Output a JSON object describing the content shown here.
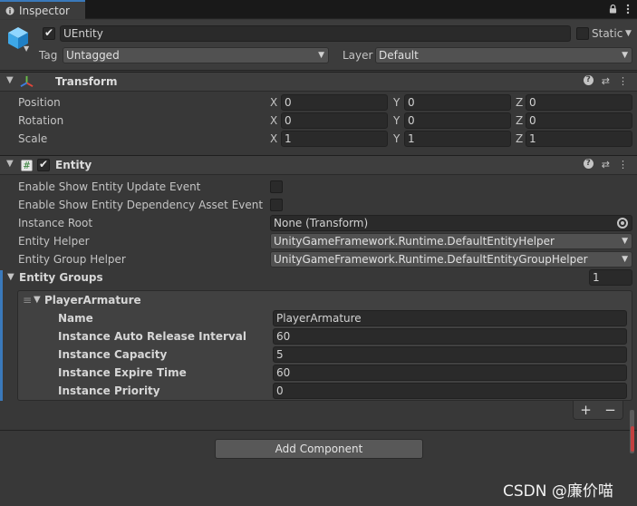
{
  "window": {
    "tab_label": "Inspector",
    "tab_icon": "info-icon",
    "lock_icon": "lock-icon",
    "menu_icon": "kebab-menu-icon"
  },
  "gameobject": {
    "active": true,
    "name": "UEntity",
    "static_label": "Static",
    "static_checked": false,
    "tag_label": "Tag",
    "tag_value": "Untagged",
    "layer_label": "Layer",
    "layer_value": "Default"
  },
  "transform": {
    "title": "Transform",
    "rows": [
      {
        "label": "Position",
        "x": "0",
        "y": "0",
        "z": "0"
      },
      {
        "label": "Rotation",
        "x": "0",
        "y": "0",
        "z": "0"
      },
      {
        "label": "Scale",
        "x": "1",
        "y": "1",
        "z": "1"
      }
    ],
    "axis_x": "X",
    "axis_y": "Y",
    "axis_z": "Z"
  },
  "entity": {
    "title": "Entity",
    "enabled": true,
    "show_update_label": "Enable Show Entity Update Event",
    "show_update_checked": false,
    "show_dependency_label": "Enable Show Entity Dependency Asset Event",
    "show_dependency_checked": false,
    "instance_root_label": "Instance Root",
    "instance_root_value": "None (Transform)",
    "entity_helper_label": "Entity Helper",
    "entity_helper_value": "UnityGameFramework.Runtime.DefaultEntityHelper",
    "group_helper_label": "Entity Group Helper",
    "group_helper_value": "UnityGameFramework.Runtime.DefaultEntityGroupHelper",
    "groups_label": "Entity Groups",
    "groups_count": "1",
    "group": {
      "title": "PlayerArmature",
      "fields": [
        {
          "label": "Name",
          "value": "PlayerArmature"
        },
        {
          "label": "Instance Auto Release Interval",
          "value": "60"
        },
        {
          "label": "Instance Capacity",
          "value": "5"
        },
        {
          "label": "Instance Expire Time",
          "value": "60"
        },
        {
          "label": "Instance Priority",
          "value": "0"
        }
      ]
    },
    "add_symbol": "+",
    "remove_symbol": "−"
  },
  "add_component_label": "Add Component",
  "watermark": "CSDN @廉价喵",
  "colors": {
    "accent": "#3a79bb",
    "background": "#383838"
  }
}
